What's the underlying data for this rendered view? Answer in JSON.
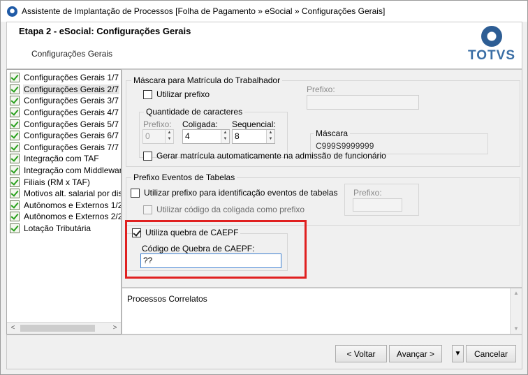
{
  "window": {
    "title": "Assistente de Implantação de Processos [Folha de Pagamento » eSocial » Configurações Gerais]"
  },
  "header": {
    "title": "Etapa 2 - eSocial: Configurações Gerais",
    "subtitle": "Configurações Gerais",
    "logo_text": "TOTVS"
  },
  "sidebar": {
    "items": [
      {
        "label": "Configurações Gerais 1/7",
        "selected": false
      },
      {
        "label": "Configurações Gerais 2/7",
        "selected": true
      },
      {
        "label": "Configurações Gerais 3/7",
        "selected": false
      },
      {
        "label": "Configurações Gerais 4/7",
        "selected": false
      },
      {
        "label": "Configurações Gerais 5/7",
        "selected": false
      },
      {
        "label": "Configurações Gerais 6/7",
        "selected": false
      },
      {
        "label": "Configurações Gerais 7/7",
        "selected": false
      },
      {
        "label": "Integração com TAF",
        "selected": false
      },
      {
        "label": "Integração com Middleware",
        "selected": false
      },
      {
        "label": "Filiais (RM x TAF)",
        "selected": false
      },
      {
        "label": "Motivos alt. salarial por diss",
        "selected": false
      },
      {
        "label": "Autônomos e Externos 1/2",
        "selected": false
      },
      {
        "label": "Autônomos e Externos 2/2",
        "selected": false
      },
      {
        "label": "Lotação Tributária",
        "selected": false
      }
    ],
    "scroll_left": "<",
    "scroll_right": ">"
  },
  "mascara": {
    "legend": "Máscara para Matrícula do Trabalhador",
    "usar_prefixo_label": "Utilizar prefixo",
    "usar_prefixo_checked": false,
    "prefixo_label": "Prefixo:",
    "prefixo_value": "",
    "quantidade_legend": "Quantidade de caracteres",
    "prefixo_qtd_label": "Prefixo:",
    "prefixo_qtd_value": "0",
    "coligada_label": "Coligada:",
    "coligada_value": "4",
    "sequencial_label": "Sequencial:",
    "sequencial_value": "8",
    "mascara_label": "Máscara",
    "mascara_value": "C999S9999999",
    "gerar_label": "Gerar matrícula automaticamente na admissão de funcionário",
    "gerar_checked": false
  },
  "prefixo_eventos": {
    "legend": "Prefixo Eventos de Tabelas",
    "utilizar_label": "Utilizar prefixo para identificação eventos de tabelas",
    "utilizar_checked": false,
    "coligada_label": "Utilizar código da coligada como prefixo",
    "coligada_checked": false,
    "prefixo_label": "Prefixo:",
    "prefixo_value": ""
  },
  "caepf": {
    "legend": "Utiliza quebra de CAEPF",
    "checked": true,
    "codigo_label": "Código de Quebra de CAEPF:",
    "codigo_value": "??"
  },
  "related": {
    "title": "Processos Correlatos"
  },
  "footer": {
    "voltar_label": "< Voltar",
    "avancar_label": "Avançar >",
    "dropdown_symbol": "▼",
    "cancelar_label": "Cancelar"
  },
  "colors": {
    "highlight": "#e02020",
    "logo": "#3a6ea5"
  }
}
